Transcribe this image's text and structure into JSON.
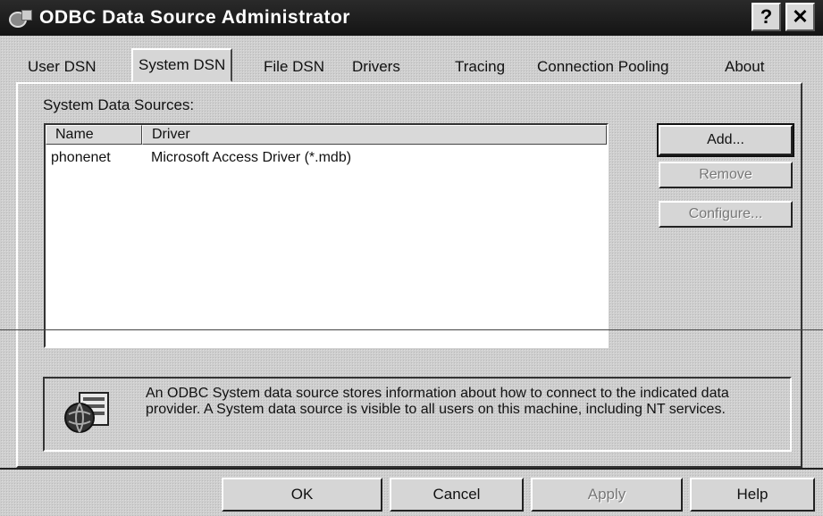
{
  "window": {
    "title": "ODBC Data Source Administrator",
    "help_glyph": "?",
    "close_glyph": "✕"
  },
  "tabs": [
    {
      "label": "User DSN",
      "active": false
    },
    {
      "label": "System DSN",
      "active": true
    },
    {
      "label": "File DSN",
      "active": false
    },
    {
      "label": "Drivers",
      "active": false
    },
    {
      "label": "Tracing",
      "active": false
    },
    {
      "label": "Connection Pooling",
      "active": false
    },
    {
      "label": "About",
      "active": false
    }
  ],
  "system_dsn": {
    "group_label": "System Data Sources:",
    "columns": [
      "Name",
      "Driver"
    ],
    "rows": [
      {
        "name": "phonenet",
        "driver": "Microsoft Access Driver (*.mdb)"
      }
    ],
    "buttons": {
      "add": "Add...",
      "remove": "Remove",
      "configure": "Configure..."
    },
    "info": {
      "icon": "odbc-globe-icon",
      "text": "An ODBC System data source stores information about how to connect to the indicated data provider.  A System data source is visible to all users on this machine, including NT services."
    }
  },
  "dialog_buttons": {
    "ok": "OK",
    "cancel": "Cancel",
    "apply": "Apply",
    "help": "Help"
  }
}
